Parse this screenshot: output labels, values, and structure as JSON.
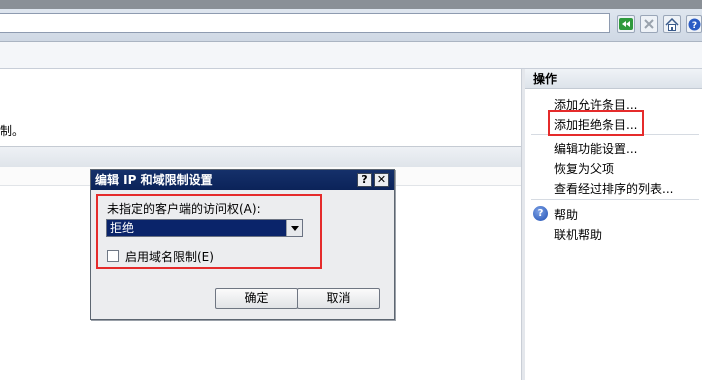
{
  "browser": {
    "toolbar_icons": [
      "refresh-go-icon",
      "stop-icon",
      "home-icon",
      "help-icon"
    ]
  },
  "main": {
    "description_fragment": "制。"
  },
  "actions": {
    "header": "操作",
    "items": [
      {
        "label": "添加允许条目..."
      },
      {
        "label": "添加拒绝条目..."
      },
      {
        "label": "编辑功能设置..."
      },
      {
        "label": "恢复为父项"
      },
      {
        "label": "查看经过排序的列表..."
      },
      {
        "label": "帮助"
      },
      {
        "label": "联机帮助"
      }
    ]
  },
  "dialog": {
    "title": "编辑 IP 和域限制设置",
    "help_button": "?",
    "close_button": "✕",
    "access_label": "未指定的客户端的访问权(A):",
    "access_value": "拒绝",
    "checkbox_label": "启用域名限制(E)",
    "checkbox_checked": false,
    "ok_label": "确定",
    "cancel_label": "取消"
  },
  "colors": {
    "highlight_box": "#e52b2b",
    "title_bar": "#0b2359",
    "selection": "#0a246a"
  }
}
